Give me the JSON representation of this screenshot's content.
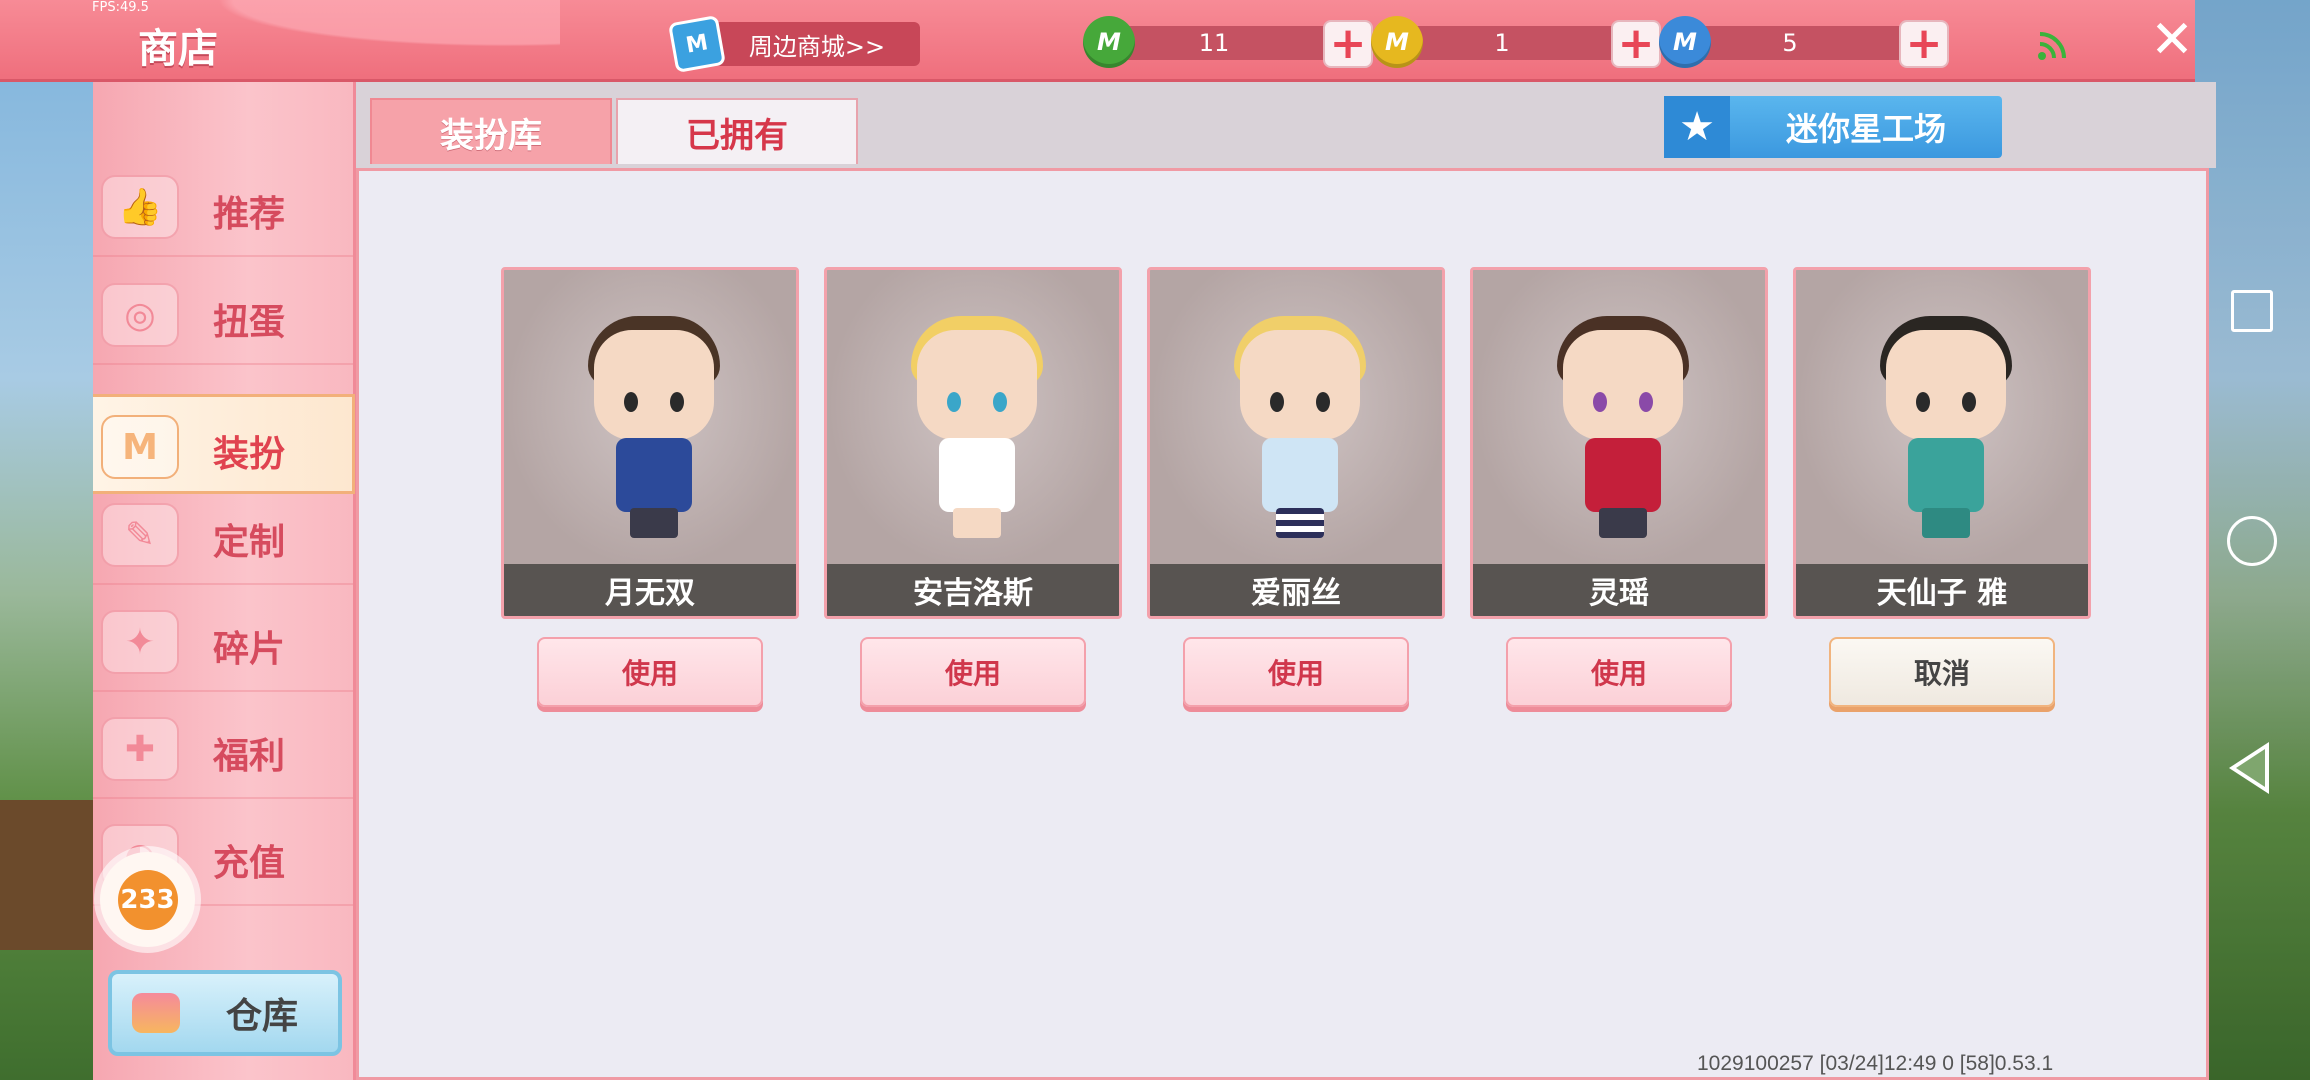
{
  "status": {
    "fps": "FPS:49.5"
  },
  "header": {
    "title": "商店",
    "merch_label": "周边商城>>",
    "merch_icon_letter": "M",
    "currencies": [
      {
        "name": "green-bean",
        "value": "11",
        "color": "#46a83a",
        "icon_letter": "M"
      },
      {
        "name": "gold-coin",
        "value": "1",
        "color": "#e6b81f",
        "icon_letter": "M"
      },
      {
        "name": "mini-coin",
        "value": "5",
        "color": "#3b8ad9",
        "icon_letter": "M"
      }
    ],
    "plus_symbol": "+",
    "close_symbol": "✕"
  },
  "sidebar": {
    "items": [
      {
        "label": "推荐",
        "icon": "thumbs-up-icon",
        "glyph": "👍"
      },
      {
        "label": "扭蛋",
        "icon": "gacha-icon",
        "glyph": "◎"
      },
      {
        "label": "装扮",
        "icon": "outfit-icon",
        "glyph": "M",
        "active": true
      },
      {
        "label": "定制",
        "icon": "customize-icon",
        "glyph": "✎"
      },
      {
        "label": "碎片",
        "icon": "fragment-icon",
        "glyph": "✦"
      },
      {
        "label": "福利",
        "icon": "gift-icon",
        "glyph": "✚"
      },
      {
        "label": "充值",
        "icon": "recharge-icon",
        "glyph": "◐"
      }
    ],
    "badge": "233",
    "warehouse_label": "仓库"
  },
  "tabs": [
    {
      "label": "装扮库",
      "active": false
    },
    {
      "label": "已拥有",
      "active": true
    }
  ],
  "workshop": {
    "label": "迷你星工场",
    "glyph": "★"
  },
  "skins": [
    {
      "name": "月无双",
      "button": "使用",
      "hair": "#4a3426",
      "outfit": "#2c4a9a",
      "accent": "#3a79b8"
    },
    {
      "name": "安吉洛斯",
      "button": "使用",
      "hair": "#f2cf64",
      "outfit": "#ffffff",
      "accent": "#e6b52a"
    },
    {
      "name": "爱丽丝",
      "button": "使用",
      "hair": "#f0cf6a",
      "outfit": "#cfe5f5",
      "accent": "#2c2f5a"
    },
    {
      "name": "灵瑶",
      "button": "使用",
      "hair": "#4a3125",
      "outfit": "#c41f3a",
      "accent": "#7a3a8e"
    },
    {
      "name": "天仙子 雅",
      "button": "取消",
      "hair": "#2a2622",
      "outfit": "#3aa39b",
      "accent": "#e8b44a"
    }
  ],
  "footer": {
    "debug": "1029100257  [03/24]12:49 0  [58]0.53.1"
  }
}
